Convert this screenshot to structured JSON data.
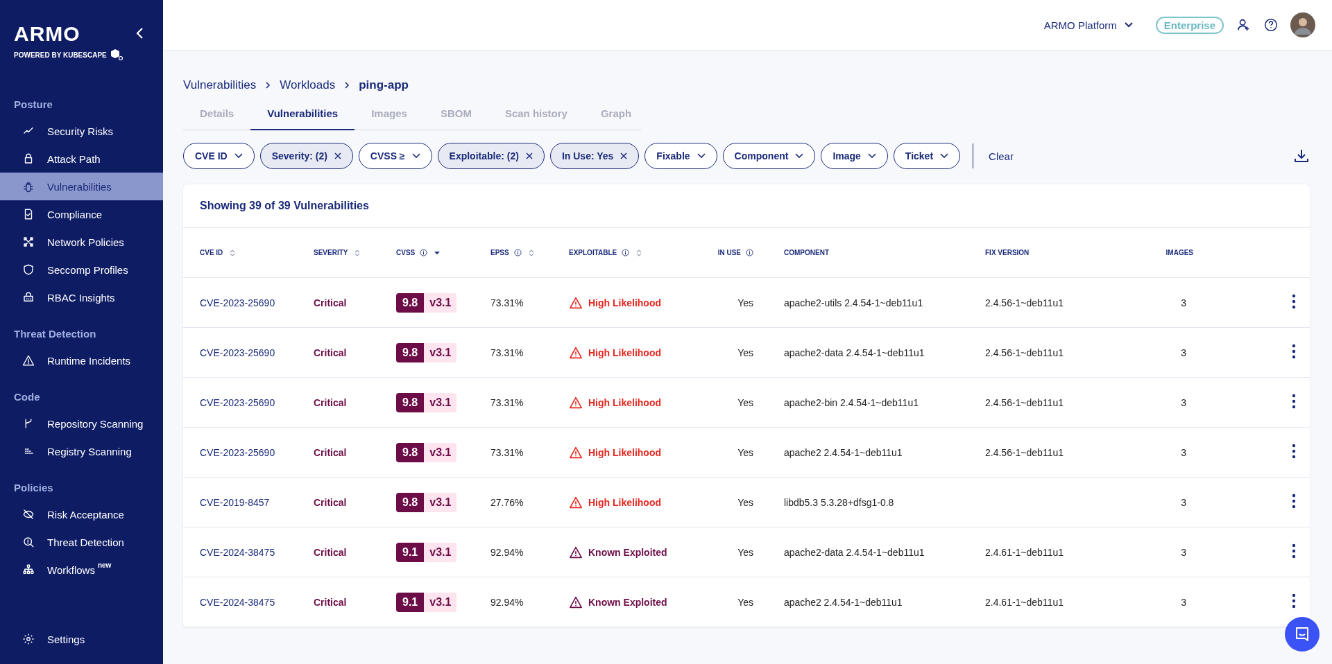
{
  "sidebar": {
    "logo": "ARMO",
    "tagline": "POWERED BY KUBESCAPE",
    "sections": [
      {
        "title": "Posture",
        "items": [
          {
            "label": "Security Risks",
            "selected": false
          },
          {
            "label": "Attack Path",
            "selected": false
          },
          {
            "label": "Vulnerabilities",
            "selected": true
          },
          {
            "label": "Compliance",
            "selected": false
          },
          {
            "label": "Network Policies",
            "selected": false
          },
          {
            "label": "Seccomp Profiles",
            "selected": false
          },
          {
            "label": "RBAC Insights",
            "selected": false
          }
        ]
      },
      {
        "title": "Threat Detection",
        "items": [
          {
            "label": "Runtime Incidents",
            "selected": false
          }
        ]
      },
      {
        "title": "Code",
        "items": [
          {
            "label": "Repository Scanning",
            "selected": false
          },
          {
            "label": "Registry Scanning",
            "selected": false
          }
        ]
      },
      {
        "title": "Policies",
        "items": [
          {
            "label": "Risk Acceptance",
            "selected": false
          },
          {
            "label": "Threat Detection",
            "selected": false
          },
          {
            "label": "Workflows",
            "badge": "new",
            "selected": false
          }
        ]
      }
    ],
    "footer": {
      "label": "Settings",
      "selected": false
    }
  },
  "header": {
    "platform": "ARMO Platform",
    "plan": "Enterprise"
  },
  "breadcrumb": [
    "Vulnerabilities",
    "Workloads",
    "ping-app"
  ],
  "tabs": [
    {
      "label": "Details",
      "selected": false
    },
    {
      "label": "Vulnerabilities",
      "selected": true
    },
    {
      "label": "Images",
      "selected": false
    },
    {
      "label": "SBOM",
      "selected": false
    },
    {
      "label": "Scan history",
      "selected": false
    },
    {
      "label": "Graph",
      "selected": false
    }
  ],
  "filters": [
    {
      "label": "CVE ID",
      "active": false
    },
    {
      "label": "Severity: (2)",
      "active": true
    },
    {
      "label": "CVSS ≥",
      "active": false
    },
    {
      "label": "Exploitable: (2)",
      "active": true
    },
    {
      "label": "In Use: Yes",
      "active": true
    },
    {
      "label": "Fixable",
      "active": false
    },
    {
      "label": "Component",
      "active": false
    },
    {
      "label": "Image",
      "active": false
    },
    {
      "label": "Ticket",
      "active": false
    }
  ],
  "clear": "Clear",
  "table": {
    "title": "Showing 39 of 39 Vulnerabilities",
    "columns": [
      {
        "label": "CVE ID",
        "info": false,
        "sortable": true,
        "sorted": false
      },
      {
        "label": "SEVERITY",
        "info": false,
        "sortable": true,
        "sorted": false
      },
      {
        "label": "CVSS",
        "info": true,
        "sortable": true,
        "sorted": true
      },
      {
        "label": "EPSS",
        "info": true,
        "sortable": true,
        "sorted": false
      },
      {
        "label": "EXPLOITABLE",
        "info": true,
        "sortable": true,
        "sorted": false
      },
      {
        "label": "IN USE",
        "info": true,
        "sortable": false,
        "sorted": false
      },
      {
        "label": "COMPONENT",
        "info": false,
        "sortable": false,
        "sorted": false
      },
      {
        "label": "FIX VERSION",
        "info": false,
        "sortable": false,
        "sorted": false
      },
      {
        "label": "IMAGES",
        "info": false,
        "sortable": false,
        "sorted": false
      }
    ],
    "rows": [
      {
        "cve": "CVE-2023-25690",
        "severity": "Critical",
        "score": "9.8",
        "version": "v3.1",
        "epss": "73.31%",
        "exploitable": {
          "kind": "high",
          "label": "High Likelihood"
        },
        "in_use": "Yes",
        "component": "apache2-utils 2.4.54-1~deb11u1",
        "fix": "2.4.56-1~deb11u1",
        "images": "3"
      },
      {
        "cve": "CVE-2023-25690",
        "severity": "Critical",
        "score": "9.8",
        "version": "v3.1",
        "epss": "73.31%",
        "exploitable": {
          "kind": "high",
          "label": "High Likelihood"
        },
        "in_use": "Yes",
        "component": "apache2-data 2.4.54-1~deb11u1",
        "fix": "2.4.56-1~deb11u1",
        "images": "3"
      },
      {
        "cve": "CVE-2023-25690",
        "severity": "Critical",
        "score": "9.8",
        "version": "v3.1",
        "epss": "73.31%",
        "exploitable": {
          "kind": "high",
          "label": "High Likelihood"
        },
        "in_use": "Yes",
        "component": "apache2-bin 2.4.54-1~deb11u1",
        "fix": "2.4.56-1~deb11u1",
        "images": "3"
      },
      {
        "cve": "CVE-2023-25690",
        "severity": "Critical",
        "score": "9.8",
        "version": "v3.1",
        "epss": "73.31%",
        "exploitable": {
          "kind": "high",
          "label": "High Likelihood"
        },
        "in_use": "Yes",
        "component": "apache2 2.4.54-1~deb11u1",
        "fix": "2.4.56-1~deb11u1",
        "images": "3"
      },
      {
        "cve": "CVE-2019-8457",
        "severity": "Critical",
        "score": "9.8",
        "version": "v3.1",
        "epss": "27.76%",
        "exploitable": {
          "kind": "high",
          "label": "High Likelihood"
        },
        "in_use": "Yes",
        "component": "libdb5.3 5.3.28+dfsg1-0.8",
        "images": "3"
      },
      {
        "cve": "CVE-2024-38475",
        "severity": "Critical",
        "score": "9.1",
        "version": "v3.1",
        "epss": "92.94%",
        "exploitable": {
          "kind": "known",
          "label": "Known Exploited"
        },
        "in_use": "Yes",
        "component": "apache2-data 2.4.54-1~deb11u1",
        "fix": "2.4.61-1~deb11u1",
        "images": "3"
      },
      {
        "cve": "CVE-2024-38475",
        "severity": "Critical",
        "score": "9.1",
        "version": "v3.1",
        "epss": "92.94%",
        "exploitable": {
          "kind": "known",
          "label": "Known Exploited"
        },
        "in_use": "Yes",
        "component": "apache2 2.4.54-1~deb11u1",
        "fix": "2.4.61-1~deb11u1",
        "images": "3"
      }
    ]
  }
}
